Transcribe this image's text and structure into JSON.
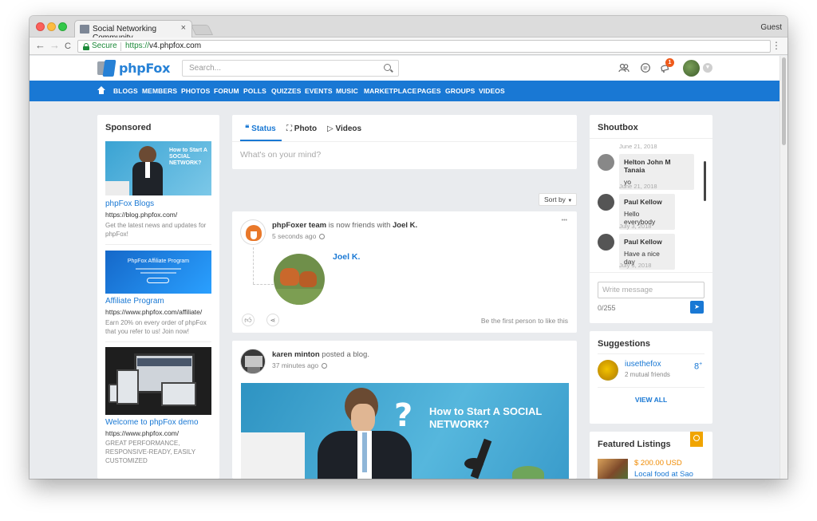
{
  "browser": {
    "tab_title": "Social Networking Community",
    "tab_close": "×",
    "profile": "Guest",
    "secure_label": "Secure",
    "url_scheme": "https://",
    "url_host": "v4.phpfox.com",
    "back": "←",
    "forward": "→",
    "reload": "C",
    "menu": "⋮"
  },
  "site": {
    "logo": "phpFox",
    "search_placeholder": "Search...",
    "notification_count": "1",
    "nav": [
      "BLOGS",
      "MEMBERS",
      "PHOTOS",
      "FORUM",
      "POLLS",
      "QUIZZES",
      "EVENTS",
      "MUSIC",
      "MARKETPLACE",
      "PAGES",
      "GROUPS",
      "VIDEOS"
    ]
  },
  "sponsored": {
    "title": "Sponsored",
    "items": [
      {
        "title": "phpFox Blogs",
        "url": "https://blog.phpfox.com/",
        "desc": "Get the latest news and updates for phpFox!",
        "img_text": "How to Start A SOCIAL NETWORK?"
      },
      {
        "title": "Affiliate Program",
        "url": "https://www.phpfox.com/affiliate/",
        "desc": "Earn 20% on every order of phpFox that you refer to us! Join now!",
        "img_text": "PhpFox Affiliate Program"
      },
      {
        "title": "Welcome to phpFox demo",
        "url": "https://www.phpfox.com/",
        "desc": "GREAT PERFORMANCE, RESPONSIVE-READY, EASILY CUSTOMIZED"
      }
    ]
  },
  "composer": {
    "tabs": [
      "Status",
      "Photo",
      "Videos"
    ],
    "placeholder": "What's on your mind?",
    "sort_label": "Sort by"
  },
  "feed": [
    {
      "author": "phpFoxer team",
      "action": "is now friends with",
      "target": "Joel K.",
      "time": "5 seconds ago",
      "friend_name": "Joel K.",
      "like_text": "Be the first person to like this",
      "more": "•••"
    },
    {
      "author": "karen minton",
      "action": "posted a blog.",
      "time": "37 minutes ago",
      "img_text": "How to Start A SOCIAL NETWORK?"
    }
  ],
  "shoutbox": {
    "title": "Shoutbox",
    "top_date": "June 21, 2018",
    "messages": [
      {
        "name": "Helton John M Tanaia",
        "text": "yo",
        "date": "June 21, 2018"
      },
      {
        "name": "Paul Kellow",
        "text": "Hello everybody",
        "date": "July 3, 2018"
      },
      {
        "name": "Paul Kellow",
        "text": "Have a nice day",
        "date": "July 3, 2018"
      }
    ],
    "input_placeholder": "Write message",
    "counter": "0/255"
  },
  "suggestions": {
    "title": "Suggestions",
    "items": [
      {
        "name": "iusethefox",
        "meta": "2 mutual friends"
      }
    ],
    "view_all": "VIEW ALL"
  },
  "featured": {
    "title": "Featured Listings",
    "items": [
      {
        "price": "$ 200.00 USD",
        "title": "Local food at Sao Paulo"
      }
    ]
  },
  "colors": {
    "brand": "#1978d4",
    "price": "#f08a00",
    "badge": "#ef5a1b"
  }
}
